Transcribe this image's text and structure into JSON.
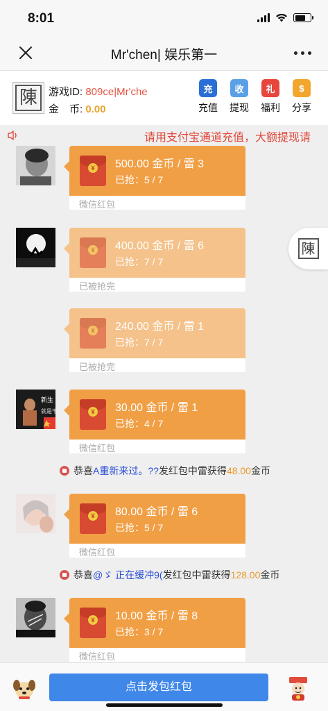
{
  "status_bar": {
    "time": "8:01",
    "battery_level": 0.7
  },
  "nav": {
    "title": "Mr'chen| 娱乐第一",
    "close_icon": "close-icon",
    "more_icon": "more-dots-icon"
  },
  "user": {
    "id_label": "游戏ID:",
    "id_value": "809ce|Mr'che",
    "coin_label": "金　币:",
    "coin_value": "0.00",
    "avatar_text": "陳"
  },
  "actions": [
    {
      "label": "充值",
      "icon": "recharge-icon",
      "glyph": "充",
      "color": "#2a6fd6"
    },
    {
      "label": "提现",
      "icon": "withdraw-icon",
      "glyph": "收",
      "color": "#5aa0e6"
    },
    {
      "label": "福利",
      "icon": "gift-icon",
      "glyph": "礼",
      "color": "#e8453c"
    },
    {
      "label": "分享",
      "icon": "share-icon",
      "glyph": "$",
      "color": "#f3a62e"
    }
  ],
  "notice": {
    "text": "请用支付宝通道充值，大额提现请",
    "icon": "speaker-icon"
  },
  "messages": [
    {
      "amount": "500.00 金币 / 雷 3",
      "grabbed": "已抢：5 / 7",
      "footer": "微信红包",
      "done": false,
      "avatar": "avatar-1"
    },
    {
      "amount": "400.00 金币 / 雷 6",
      "grabbed": "已抢：7 / 7",
      "footer": "已被抢完",
      "done": true,
      "avatar": "avatar-2"
    },
    {
      "amount": "240.00 金币 / 雷 1",
      "grabbed": "已抢：7 / 7",
      "footer": "已被抢完",
      "done": true,
      "avatar": ""
    },
    {
      "amount": "30.00 金币 / 雷 1",
      "grabbed": "已抢：4 / 7",
      "footer": "微信红包",
      "done": false,
      "avatar": "avatar-3"
    },
    {
      "amount": "80.00 金币 / 雷 6",
      "grabbed": "已抢：5 / 7",
      "footer": "微信红包",
      "done": false,
      "avatar": "avatar-4"
    },
    {
      "amount": "10.00 金币 / 雷 8",
      "grabbed": "已抢：3 / 7",
      "footer": "微信红包",
      "done": false,
      "avatar": "avatar-5"
    }
  ],
  "system_notes": [
    {
      "prefix": "恭喜 ",
      "name": "A重新来过。??",
      "middle": " 发红包中雷获得 ",
      "amount": "48.00",
      "suffix": " 金币"
    },
    {
      "prefix": "恭喜 ",
      "name": "@ゞ 正在缓冲9(",
      "middle": "发红包中雷获得 ",
      "amount": "128.00",
      "suffix": " 金币"
    }
  ],
  "float_button": {
    "text": "陳"
  },
  "bottom": {
    "send_label": "点击发包红包"
  }
}
